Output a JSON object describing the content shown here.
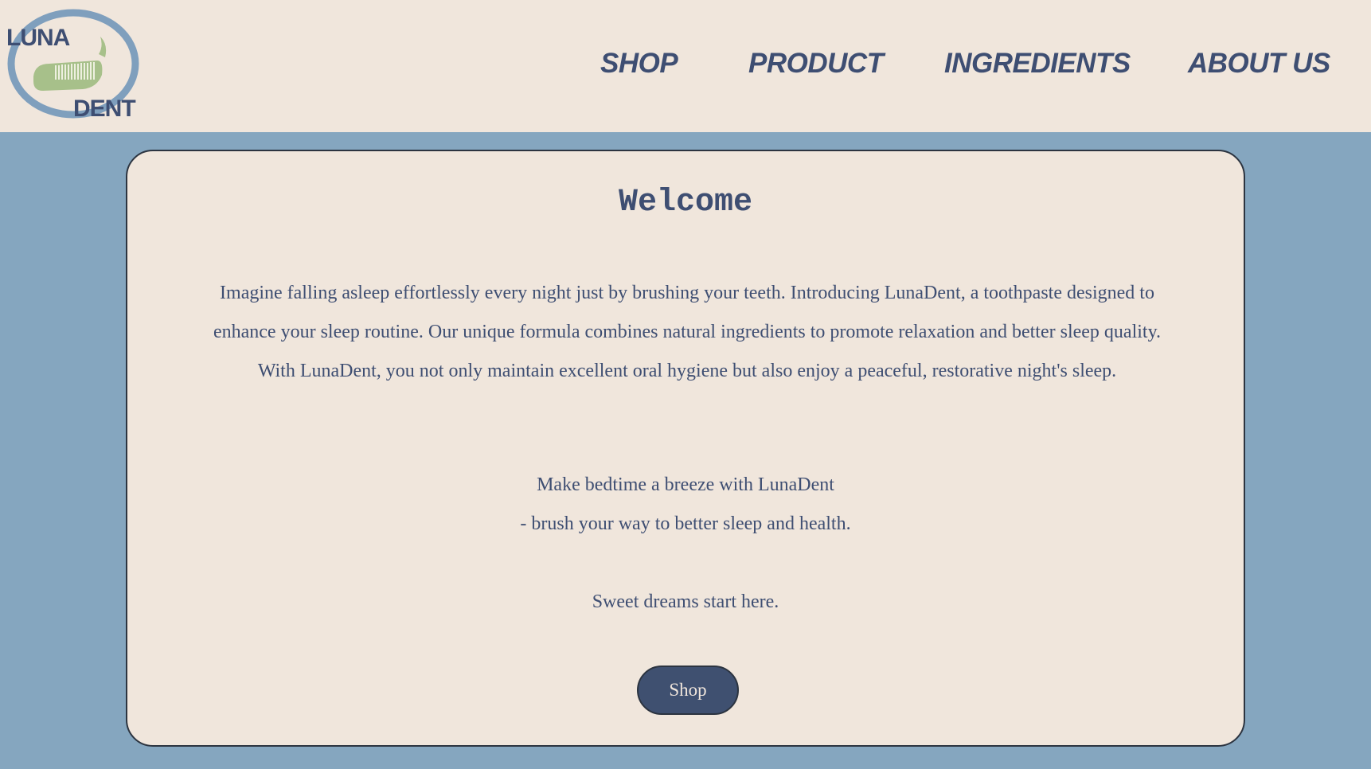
{
  "brand": {
    "logo_line1": "LUNA",
    "logo_line2": "DENT",
    "logo_colors": {
      "ring": "#7f9fbd",
      "toothbrush": "#a7c08a",
      "text": "#3e4e72"
    }
  },
  "nav": {
    "items": [
      {
        "label": "SHOP"
      },
      {
        "label": "PRODUCT"
      },
      {
        "label": "INGREDIENTS"
      },
      {
        "label": "ABOUT US"
      }
    ]
  },
  "main": {
    "title": "Welcome",
    "intro": "Imagine falling asleep effortlessly every night just by brushing your teeth. Introducing LunaDent, a toothpaste designed to enhance your sleep routine. Our unique formula combines natural ingredients to promote relaxation and better sleep quality. With LunaDent, you not only maintain excellent oral hygiene but also enjoy a peaceful, restorative night's sleep.",
    "tagline_line1": "Make bedtime a breeze with LunaDent",
    "tagline_line2": "- brush your way to better sleep and health.",
    "closing": "Sweet dreams start here.",
    "shop_button_label": "Shop"
  },
  "colors": {
    "page_background": "#85a6bf",
    "panel_background": "#f0e6dc",
    "text_primary": "#3e4e72",
    "button_background": "#3f5070",
    "button_text": "#f0e6dc"
  }
}
